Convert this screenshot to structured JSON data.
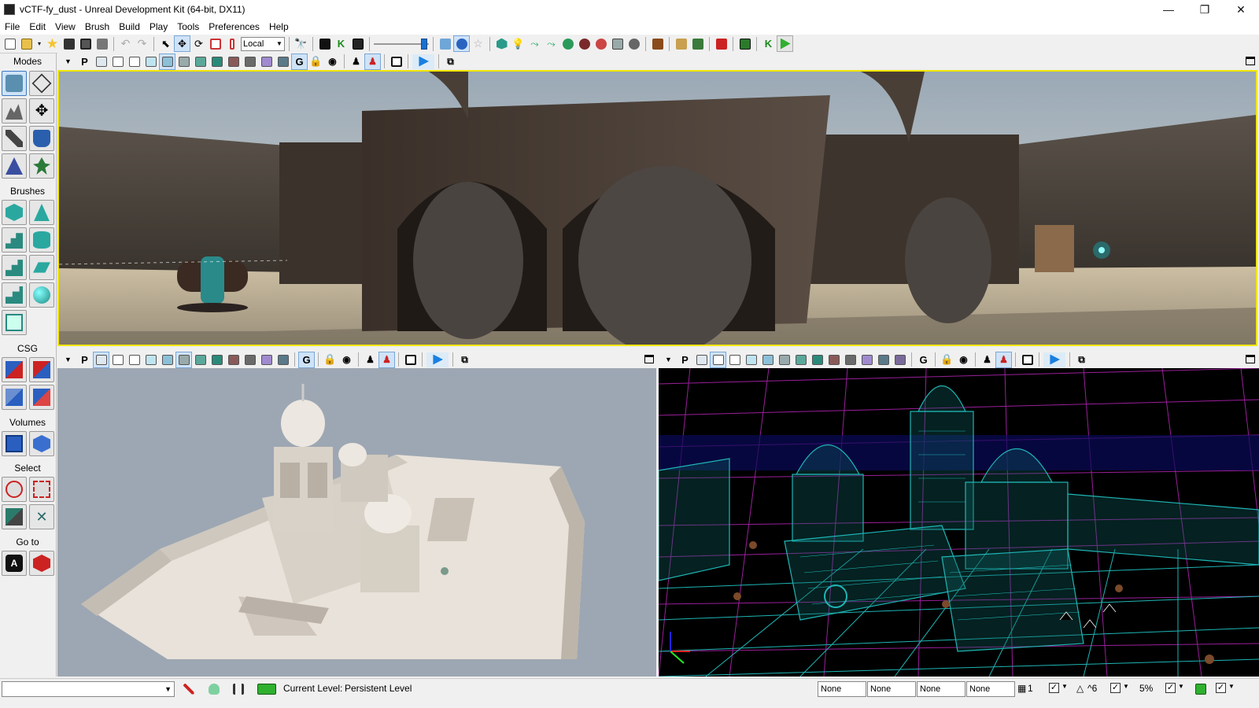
{
  "window": {
    "title": "vCTF-fy_dust - Unreal Development Kit (64-bit, DX11)",
    "minimize": "—",
    "maximize": "❐",
    "close": "✕"
  },
  "menu": [
    "File",
    "Edit",
    "View",
    "Brush",
    "Build",
    "Play",
    "Tools",
    "Preferences",
    "Help"
  ],
  "toolbar": {
    "coord_system": "Local"
  },
  "left_panel": {
    "sections": [
      "Modes",
      "Brushes",
      "CSG",
      "Volumes",
      "Select",
      "Go to"
    ]
  },
  "viewports": {
    "toolbar_label_p": "P",
    "toolbar_label_g": "G",
    "perspective": {
      "name": "perspective-viewport"
    },
    "top": {
      "name": "lit-top-viewport"
    },
    "wire": {
      "name": "wireframe-viewport"
    }
  },
  "status": {
    "current_level_label": "Current Level:",
    "current_level_value": "Persistent Level",
    "fields": [
      "None",
      "None",
      "None",
      "None"
    ],
    "grid_value": "1",
    "rotation_value": "^6",
    "scale_value": "5%",
    "check_mark": "✓"
  },
  "colors": {
    "active_viewport_border": "#f2e600",
    "wire_teal": "#1fb5b5",
    "wire_magenta": "#9a1f9a",
    "play_green": "#2fb02f"
  }
}
